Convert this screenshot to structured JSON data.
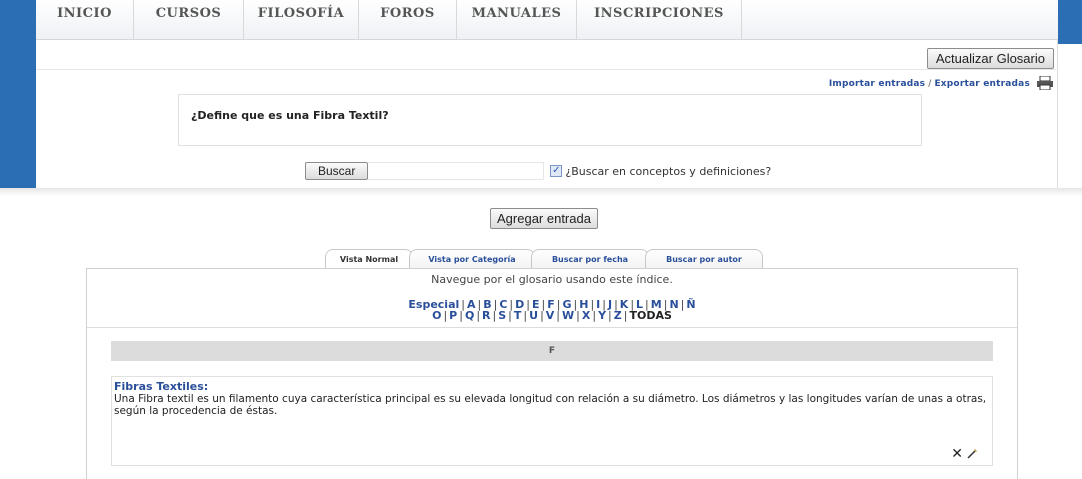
{
  "nav": {
    "items": [
      "INICIO",
      "CURSOS",
      "FILOSOFÍA",
      "FOROS",
      "MANUALES",
      "INSCRIPCIONES"
    ]
  },
  "glossary": {
    "update_label": "Actualizar Glosario",
    "import_label": "Importar entradas",
    "separator": "/",
    "export_label": "Exportar entradas",
    "question": "¿Define que es una Fibra Textil?",
    "search_button": "Buscar",
    "search_value": "",
    "search_checkbox_label": "¿Buscar en conceptos y definiciones?",
    "search_checkbox_checked": true,
    "add_entry_label": "Agregar entrada",
    "tabs": [
      "Vista Normal",
      "Vista por Categoría",
      "Buscar por fecha",
      "Buscar por autor"
    ],
    "browse_note": "Navegue por el glosario usando este índice.",
    "alphabet_row1": [
      "Especial",
      "A",
      "B",
      "C",
      "D",
      "E",
      "F",
      "G",
      "H",
      "I",
      "J",
      "K",
      "L",
      "M",
      "N",
      "Ñ"
    ],
    "alphabet_row2": [
      "O",
      "P",
      "Q",
      "R",
      "S",
      "T",
      "U",
      "V",
      "W",
      "X",
      "Y",
      "Z"
    ],
    "all_label": "TODAS",
    "current_letter": "F",
    "entry_title": "Fibras Textiles:",
    "entry_body": "Una Fibra textil es un filamento cuya característica principal es su elevada longitud con relación a su diámetro. Los diámetros y las longitudes varían de unas a otras, según la procedencia de éstas."
  },
  "colors": {
    "accent_blue": "#2c6eb3",
    "link": "#2a4f9a"
  }
}
